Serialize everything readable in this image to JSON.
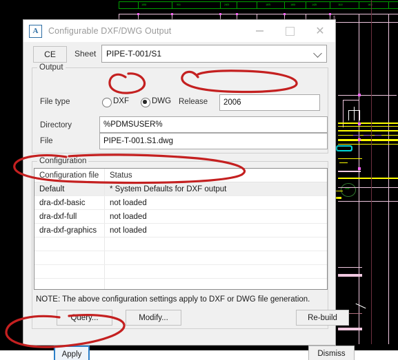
{
  "window": {
    "title": "Configurable DXF/DWG Output",
    "app_icon": "A",
    "minimize": "—",
    "maximize": "□",
    "close": "✕"
  },
  "toolbar": {
    "ce_label": "CE",
    "sheet_label": "Sheet",
    "sheet_value": "PIPE-T-001/S1",
    "caret_icon": "chevron-down-icon"
  },
  "output": {
    "group_title": "Output",
    "file_type_label": "File type",
    "options": [
      {
        "label": "DXF",
        "selected": false
      },
      {
        "label": "DWG",
        "selected": true
      }
    ],
    "dxf_label": "DXF",
    "dwg_label": "DWG",
    "release_label": "Release",
    "release_value": "2006",
    "directory_label": "Directory",
    "directory_value": "%PDMSUSER%",
    "file_label": "File",
    "file_value": "PIPE-T-001.S1.dwg"
  },
  "configuration": {
    "group_title": "Configuration",
    "columns": [
      "Configuration file",
      "Status"
    ],
    "rows": [
      {
        "name": "Default",
        "status": "* System Defaults for DXF output",
        "selected": true
      },
      {
        "name": "dra-dxf-basic",
        "status": "not loaded",
        "selected": false
      },
      {
        "name": "dra-dxf-full",
        "status": "not loaded",
        "selected": false
      },
      {
        "name": "dra-dxf-graphics",
        "status": "not loaded",
        "selected": false
      }
    ],
    "empty_row_count": 4,
    "note": "NOTE: The above configuration settings apply to DXF or DWG file generation.",
    "query_label": "Query...",
    "modify_label": "Modify...",
    "rebuild_label": "Re-build"
  },
  "footer": {
    "apply_label": "Apply",
    "dismiss_label": "Dismiss"
  },
  "annotations": {
    "color": "#c42020",
    "marks": [
      "ellipse-around-dwg-radio",
      "ellipse-around-release-field",
      "ellipse-around-default-config-row",
      "ellipse-around-apply-button"
    ]
  },
  "background": {
    "type": "cad-drawing-viewport",
    "canvas_color": "#000000",
    "accent_colors": {
      "dimension": "#00a000",
      "outline": "#f0c8e0",
      "pipe": "#ffff00",
      "node": "#ff66ff",
      "fill": "#00d8d8"
    },
    "dimension_labels": [
      "1050",
      "915",
      "2400",
      "1875",
      "1650",
      "1425",
      "1110",
      "1800",
      "1515",
      "2100"
    ]
  }
}
